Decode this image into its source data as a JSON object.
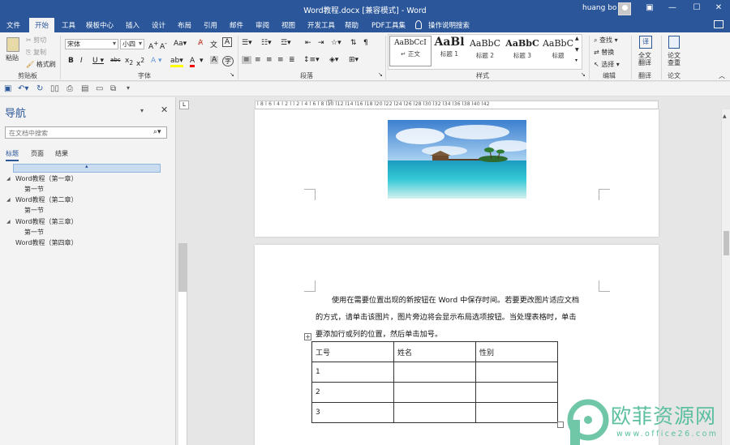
{
  "app": {
    "title": "Word教程.docx [兼容模式] - Word",
    "user": "huang bo"
  },
  "tabs": [
    "文件",
    "开始",
    "工具",
    "模板中心",
    "插入",
    "设计",
    "布局",
    "引用",
    "邮件",
    "审阅",
    "视图",
    "开发工具",
    "帮助",
    "PDF工具集"
  ],
  "active_tab": "开始",
  "tell_me": "操作说明搜索",
  "ribbon": {
    "clipboard": {
      "paste": "粘贴",
      "cut": "剪切",
      "copy": "复制",
      "format_painter": "格式刷",
      "label": "剪贴板"
    },
    "font": {
      "name": "宋体",
      "size": "小四",
      "label": "字体"
    },
    "paragraph": {
      "label": "段落"
    },
    "styles": {
      "label": "样式",
      "items": [
        {
          "sample": "AaBbCcI",
          "name": "↵ 正文"
        },
        {
          "sample": "AaBl",
          "name": "标题 1"
        },
        {
          "sample": "AaBbC",
          "name": "标题 2"
        },
        {
          "sample": "AaBbC",
          "name": "标题 3"
        },
        {
          "sample": "AaBbC",
          "name": "标题"
        }
      ]
    },
    "editing": {
      "find": "查找",
      "replace": "替换",
      "select": "选择",
      "label": "编辑"
    },
    "translate": {
      "full_text": "全文\n翻译",
      "label": "翻译"
    },
    "paper": {
      "check": "论文\n查重",
      "label": "论文"
    }
  },
  "nav": {
    "title": "导航",
    "search_placeholder": "在文档中搜索",
    "tabs": [
      "标题",
      "页面",
      "结果"
    ],
    "items": [
      {
        "label": "Word教程（第一章）",
        "level": 1
      },
      {
        "label": "第一节",
        "level": 2
      },
      {
        "label": "Word教程（第二章）",
        "level": 1
      },
      {
        "label": "第一节",
        "level": 2
      },
      {
        "label": "Word教程（第三章）",
        "level": 1
      },
      {
        "label": "第一节",
        "level": 2
      },
      {
        "label": "Word教程（第四章）",
        "level": 1
      }
    ]
  },
  "ruler": {
    "text": "l 8 l 6 l 4 l 2 l   l 2 l 4 l 6 l 8 l10 l12 l14 l16 l18 l20 l22 l24 l26 l28 l30 l32 l34 l36 l38 l40 l42"
  },
  "document": {
    "paragraph_lines": [
      "使用在需要位置出现的新按钮在 Word 中保存时间。若要更改图片适应文档",
      "的方式，请单击该图片，图片旁边将会显示布局选项按钮。当处理表格时，单击",
      "要添加行或列的位置，然后单击加号。"
    ],
    "table": {
      "headers": [
        "工号",
        "姓名",
        "性别"
      ],
      "rows": [
        [
          "1",
          "",
          ""
        ],
        [
          "2",
          "",
          ""
        ],
        [
          "3",
          "",
          ""
        ]
      ]
    }
  },
  "watermark": {
    "text": "欧菲资源网",
    "url": "www.office26.com"
  }
}
